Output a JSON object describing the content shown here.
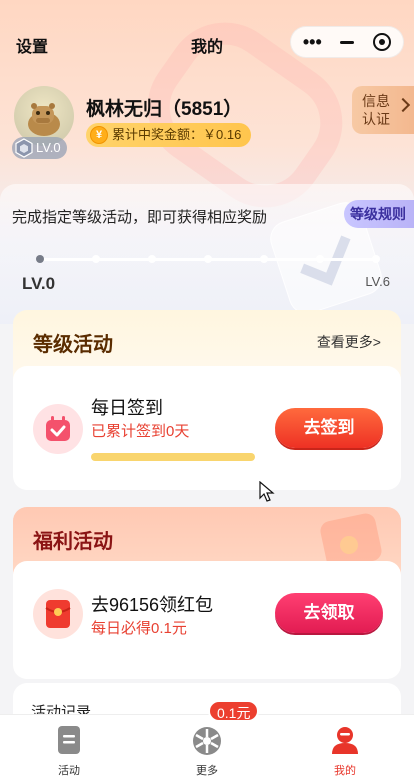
{
  "nav": {
    "left_label": "设置",
    "title": "我的"
  },
  "profile": {
    "username": "枫林无归（5851）",
    "level_badge": "LV.0",
    "prize_label": "累计中奖金额：￥0.16",
    "coin_symbol": "¥",
    "info_button": [
      "信息",
      "认证"
    ]
  },
  "level": {
    "tip": "完成指定等级活动，即可获得相应奖励",
    "rules_button": "等级规则",
    "start_label": "LV.0",
    "end_label": "LV.6",
    "current_level": 0,
    "max_level": 6
  },
  "level_activities": {
    "title": "等级活动",
    "more": "查看更多>",
    "task": {
      "name": "每日签到",
      "sub": "已累计签到0天",
      "button": "去签到"
    }
  },
  "welfare_activities": {
    "title": "福利活动",
    "task": {
      "name": "去96156领红包",
      "sub": "每日必得0.1元",
      "button": "去领取"
    }
  },
  "records": {
    "title": "活动记录"
  },
  "tabbar": {
    "items": [
      {
        "label": "活动",
        "icon": "document-icon"
      },
      {
        "label": "更多",
        "icon": "wheel-icon"
      },
      {
        "label": "我的",
        "icon": "user-icon"
      }
    ],
    "active_index": 2,
    "badge": "0.1元"
  },
  "colors": {
    "accent_red": "#e8352a",
    "sign_button": "#f2432c",
    "claim_button": "#e8245f",
    "progress": "#f9d56e"
  }
}
